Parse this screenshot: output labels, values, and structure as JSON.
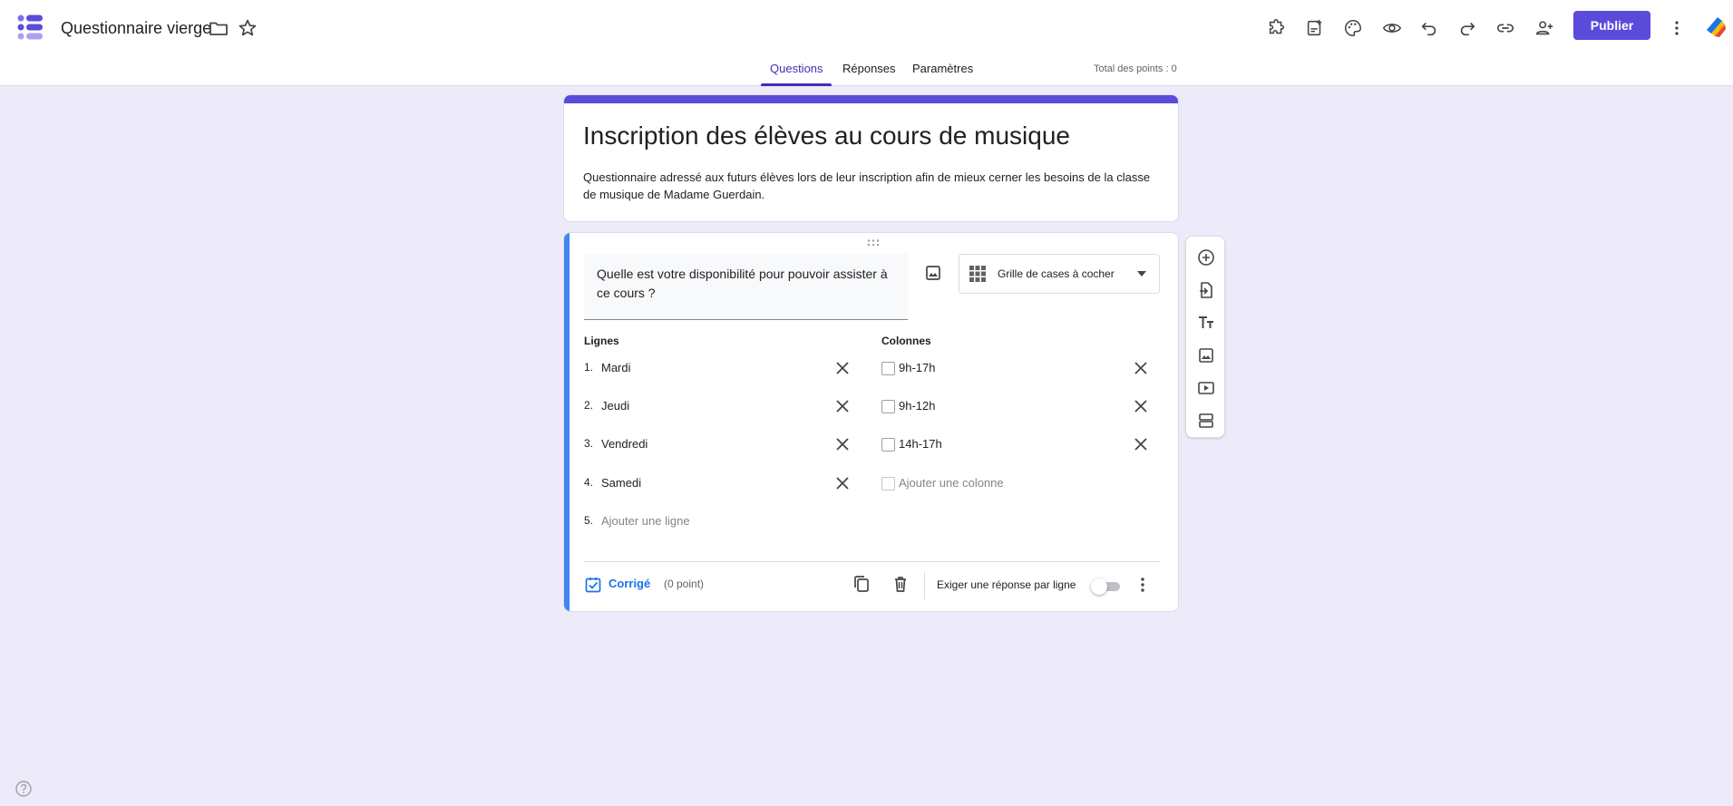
{
  "header": {
    "doc_title": "Questionnaire vierge",
    "publish_label": "Publier",
    "icons": [
      "addon-icon",
      "templates-icon",
      "palette-icon",
      "preview-icon",
      "undo-icon",
      "redo-icon",
      "link-icon",
      "add-collaborator-icon",
      "more-vert-icon"
    ]
  },
  "tabs": {
    "questions": "Questions",
    "responses": "Réponses",
    "settings": "Paramètres",
    "points_total": "Total des points : 0"
  },
  "form": {
    "title": "Inscription des élèves au cours de musique",
    "description": "Questionnaire adressé aux futurs élèves lors de leur inscription afin de mieux cerner les besoins de la classe de musique de Madame Guerdain."
  },
  "question": {
    "text": "Quelle est votre disponibilité pour pouvoir assister à ce cours ?",
    "type": "Grille de cases à cocher",
    "rows_header": "Lignes",
    "columns_header": "Colonnes",
    "rows": [
      {
        "num": "1.",
        "label": "Mardi"
      },
      {
        "num": "2.",
        "label": "Jeudi"
      },
      {
        "num": "3.",
        "label": "Vendredi"
      },
      {
        "num": "4.",
        "label": "Samedi"
      }
    ],
    "add_row": {
      "num": "5.",
      "label": "Ajouter une ligne"
    },
    "columns": [
      {
        "label": "9h-17h"
      },
      {
        "label": "9h-12h"
      },
      {
        "label": "14h-17h"
      }
    ],
    "add_column": "Ajouter une colonne",
    "answer_key": "Corrigé",
    "points": "(0 point)",
    "require_label": "Exiger une réponse par ligne",
    "require_on": false
  },
  "colors": {
    "accent": "#5b4bdb",
    "tab_active": "#4131b0",
    "question_bar": "#4285f4",
    "link": "#1a73e8",
    "background": "#edebfa"
  }
}
